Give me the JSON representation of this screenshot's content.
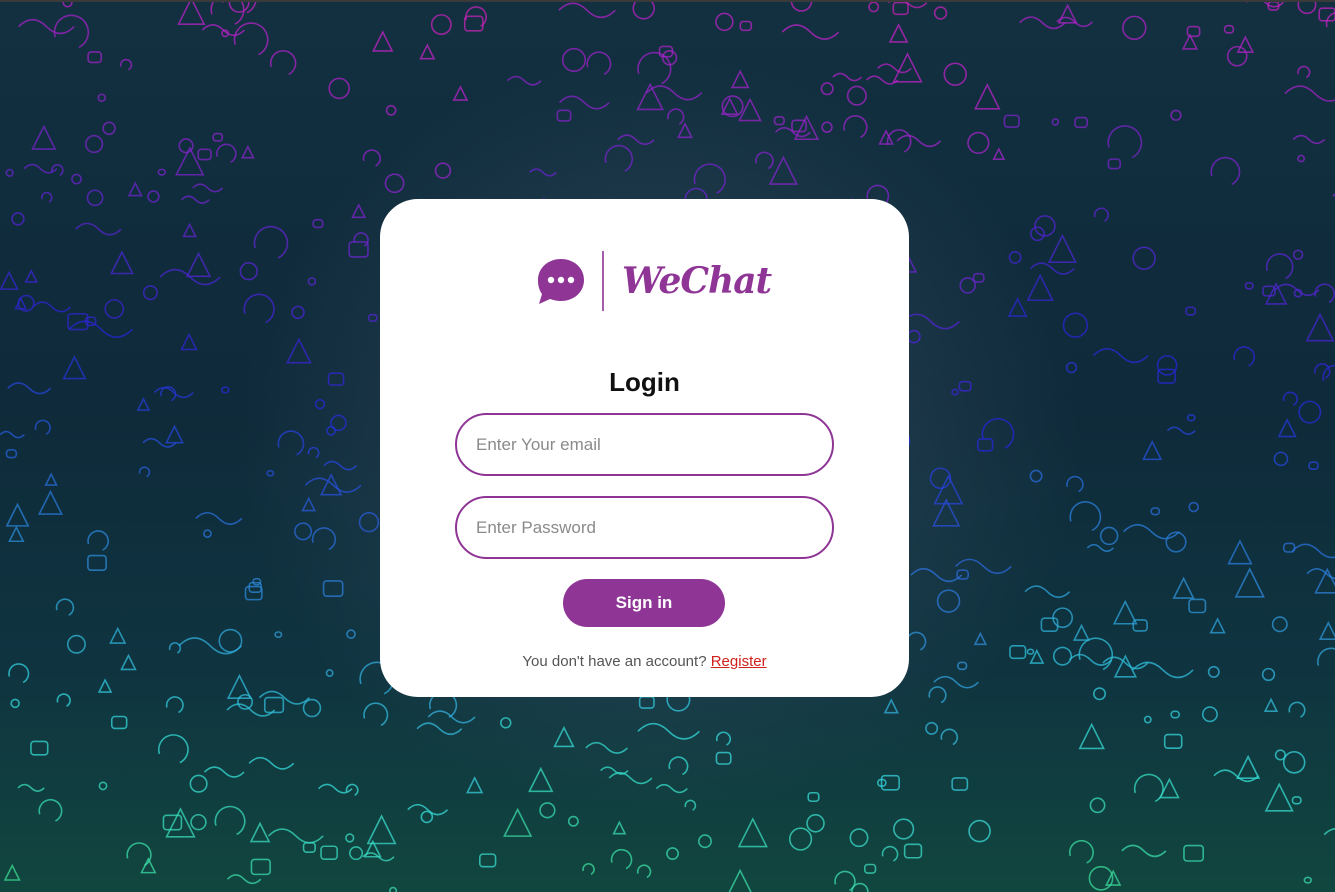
{
  "app": {
    "logo_text": "WeChat",
    "logo_icon": "chat-bubble-icon"
  },
  "login": {
    "title": "Login",
    "email_placeholder": "Enter Your email",
    "email_value": "",
    "password_placeholder": "Enter Password",
    "password_value": "",
    "signin_label": "Sign in",
    "no_account_text": "You don't have an account?",
    "register_label": "Register"
  },
  "colors": {
    "brand": "#8e3595",
    "link": "#d0201b",
    "card": "#ffffff"
  }
}
